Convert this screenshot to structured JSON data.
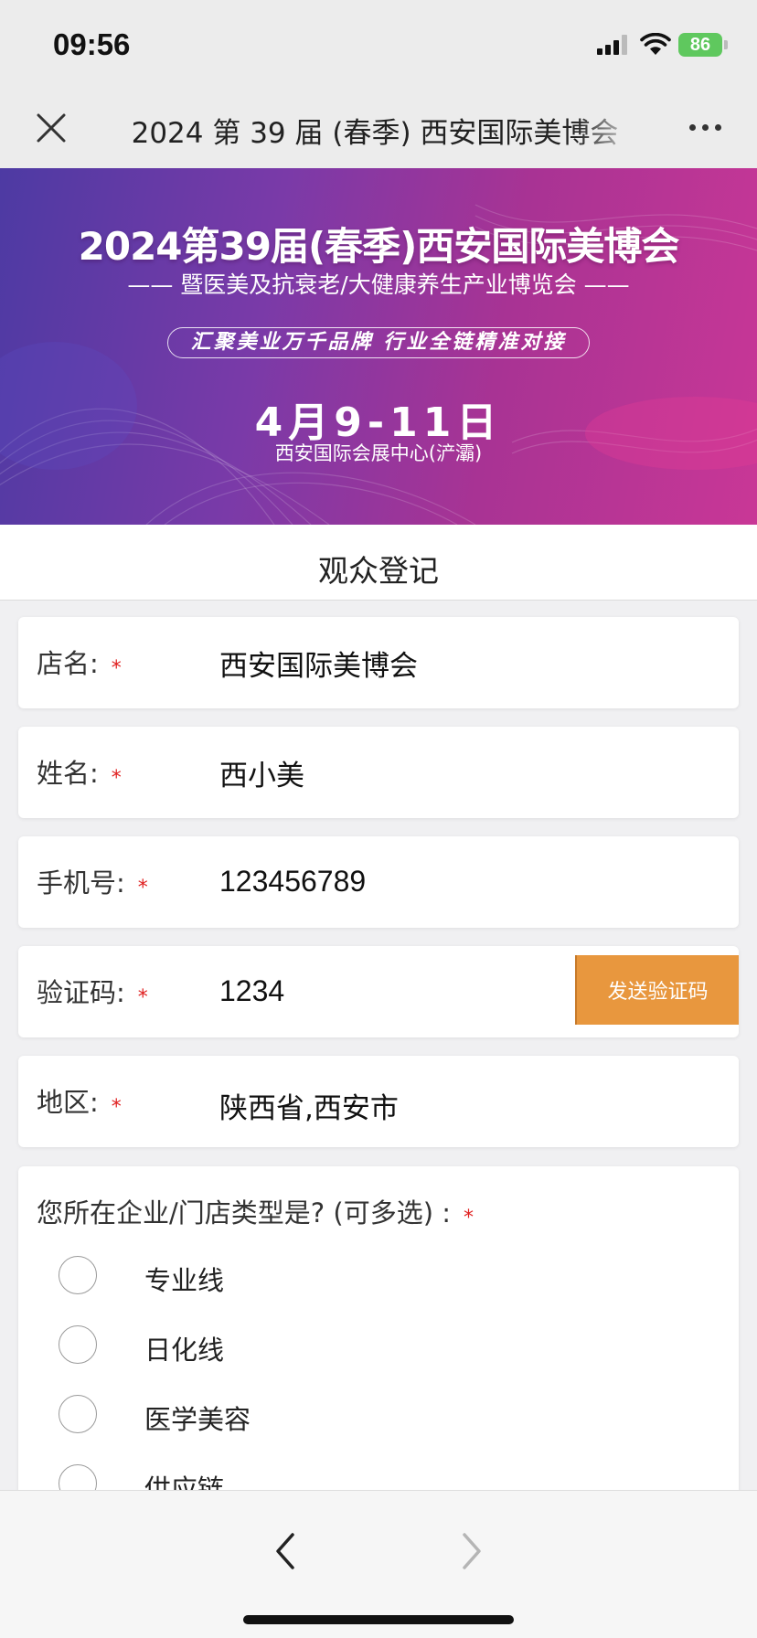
{
  "status_bar": {
    "time": "09:56",
    "battery": "86"
  },
  "nav": {
    "title": "2024 第 39 届 (春季) 西安国际美博会"
  },
  "banner": {
    "title": "2024第39届(春季)西安国际美博会",
    "subtitle": "—— 暨医美及抗衰老/大健康养生产业博览会 ——",
    "slogan": "汇聚美业万千品牌   行业全链精准对接",
    "date": "4月9-11日",
    "venue": "西安国际会展中心(浐灞)"
  },
  "section": {
    "title": "观众登记"
  },
  "form": {
    "required_mark": "*",
    "store_name": {
      "label": "店名:",
      "value": "西安国际美博会"
    },
    "name": {
      "label": "姓名:",
      "value": "西小美"
    },
    "phone": {
      "label": "手机号:",
      "value": "123456789"
    },
    "code": {
      "label": "验证码:",
      "value": "1234",
      "send_button": "发送验证码"
    },
    "region": {
      "label": "地区:",
      "value": "陕西省,西安市"
    },
    "business_type": {
      "question": "您所在企业/门店类型是? (可多选) :",
      "options": [
        "专业线",
        "日化线",
        "医学美容",
        "供应链"
      ]
    }
  },
  "colors": {
    "accent_button": "#e8973e",
    "required": "#e02020",
    "battery": "#5fc85e",
    "banner_start": "#4d3aa3",
    "banner_end": "#c93796"
  },
  "icons": {
    "close": "close-icon",
    "more": "more-icon",
    "back": "chevron-left-icon",
    "forward": "chevron-right-icon"
  }
}
